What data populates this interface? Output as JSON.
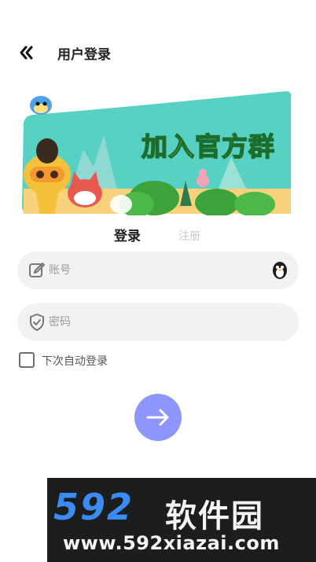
{
  "header": {
    "title": "用户登录",
    "back_icon": "double-chevron-left-icon"
  },
  "banner": {
    "title": "加入官方群"
  },
  "tabs": {
    "login": "登录",
    "register": "注册"
  },
  "form": {
    "account_placeholder": "账号",
    "password_placeholder": "密码",
    "remember_label": "下次自动登录",
    "remember_checked": false
  },
  "watermark": {
    "brand": "592",
    "name": "软件园",
    "url": "www.592xiazai.com"
  },
  "colors": {
    "accent": "#8d97fb",
    "field_bg": "#f2f2f2",
    "banner_bg": "#56d1c4"
  }
}
